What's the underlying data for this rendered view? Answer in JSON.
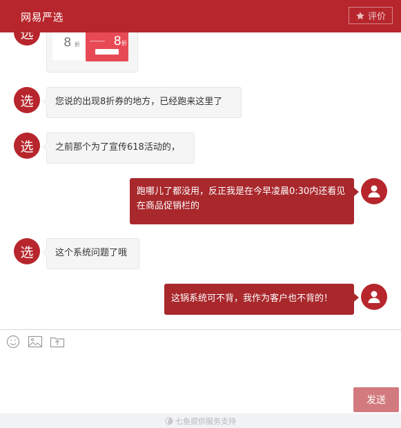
{
  "header": {
    "title": "网易严选",
    "rate_label": "评价"
  },
  "messages": [
    {
      "side": "left",
      "type": "image",
      "avatar_char": "选",
      "coupon": {
        "left_value": "8",
        "left_unit": "折",
        "right_value": "8",
        "right_unit": "折"
      }
    },
    {
      "side": "left",
      "type": "text",
      "avatar_char": "选",
      "text": "您说的出现8折券的地方，已经跑来这里了"
    },
    {
      "side": "left",
      "type": "text",
      "avatar_char": "选",
      "text": "之前那个为了宣传618活动的，"
    },
    {
      "side": "right",
      "type": "text",
      "text": "跑哪儿了都没用，反正我是在今早凌晨0:30内还看见在商品促销栏的"
    },
    {
      "side": "left",
      "type": "text",
      "avatar_char": "选",
      "text": "这个系统问题了哦"
    },
    {
      "side": "right",
      "type": "text",
      "text": "这锅系统可不背，我作为客户也不背的！"
    }
  ],
  "composer": {
    "tools": [
      "emoji-icon",
      "image-icon",
      "upload-icon"
    ],
    "send_label": "发送",
    "input_value": ""
  },
  "footer": {
    "text": "七鱼提供服务支持"
  },
  "colors": {
    "brand": "#b7262c",
    "user_bubble": "#a8282c",
    "send_button": "#d27a7e"
  }
}
